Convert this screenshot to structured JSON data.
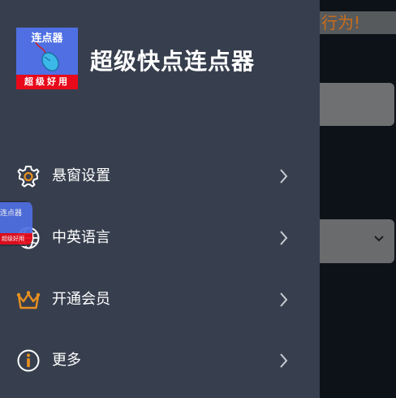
{
  "background": {
    "banner_text": "行为!"
  },
  "drawer": {
    "logo": {
      "top_text": "连点器",
      "bottom_text": "超级好用"
    },
    "app_title": "超级快点连点器",
    "items": [
      {
        "label": "悬窗设置",
        "icon": "gear-icon"
      },
      {
        "label": "中英语言",
        "icon": "globe-icon"
      },
      {
        "label": "开通会员",
        "icon": "crown-icon"
      },
      {
        "label": "更多",
        "icon": "info-icon"
      }
    ]
  },
  "floating_widget": {
    "top_text": "连点器",
    "bottom_text": "超级好用"
  },
  "colors": {
    "drawer_bg": "#373f4e",
    "accent": "#e8901e",
    "logo_blue": "#4f6fe3",
    "logo_red": "#e8091a"
  }
}
